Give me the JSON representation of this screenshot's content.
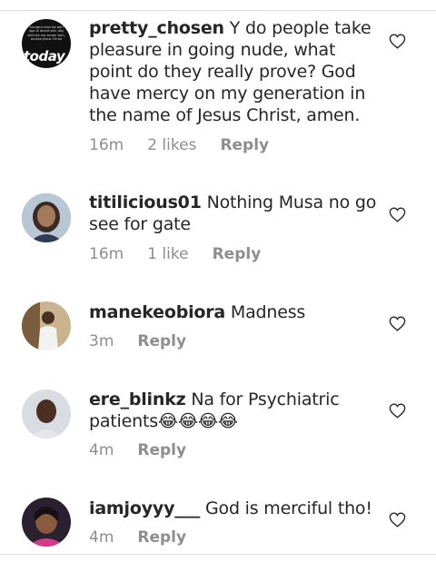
{
  "comments": [
    {
      "username": "pretty_chosen",
      "text": "Y do people take pleasure in going nude, what point do they really prove? God have mercy on my generation in the name of Jesus Christ, amen.",
      "time": "16m",
      "likes": "2 likes",
      "reply_label": "Reply",
      "avatar_text": "today",
      "avatar_small_text": "Sacagra man ba bari nga ik lonalli ann day with ba ma asnan tom, accept Jesus Christ"
    },
    {
      "username": "titilicious01",
      "text": "Nothing Musa no go see for gate",
      "time": "16m",
      "likes": "1 like",
      "reply_label": "Reply"
    },
    {
      "username": "manekeobiora",
      "text": "Madness",
      "time": "3m",
      "reply_label": "Reply"
    },
    {
      "username": "ere_blinkz",
      "text": "Na for Psychiatric patients😂😂😂😂",
      "time": "4m",
      "reply_label": "Reply"
    },
    {
      "username": "iamjoyyy___",
      "text": "God is merciful tho!",
      "time": "4m",
      "reply_label": "Reply"
    }
  ]
}
